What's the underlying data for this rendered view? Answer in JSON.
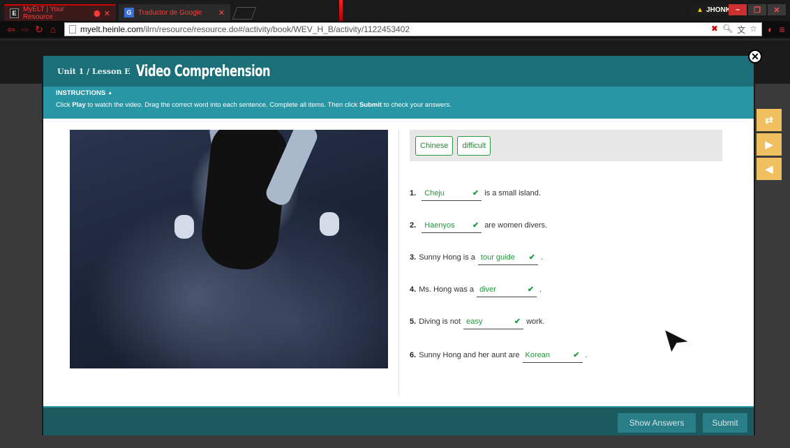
{
  "browser": {
    "tabs": [
      {
        "label": "MyELT | Your Resource",
        "icon": "E"
      },
      {
        "label": "Traductor de Google",
        "icon": "G"
      }
    ],
    "profile_name": "JHONKA",
    "url_host": "myelt.heinle.com",
    "url_path": "/ilrn/resource/resource.do#/activity/book/WEV_H_B/activity/1122453402"
  },
  "modal": {
    "lesson_label": "Unit 1 / Lesson E",
    "title": "Video Comprehension",
    "instructions_title": "INSTRUCTIONS",
    "instructions_pre": "Click ",
    "instructions_play": "Play",
    "instructions_mid": " to watch the video. Drag the correct word into each sentence. Complete all items. Then click ",
    "instructions_submit": "Submit",
    "instructions_post": " to check your answers."
  },
  "word_bank": [
    "Chinese",
    "difficult"
  ],
  "items": [
    {
      "num": "1.",
      "pre": "",
      "answer": "Cheju",
      "post": "is a small island."
    },
    {
      "num": "2.",
      "pre": "",
      "answer": "Haenyos",
      "post": "are women divers."
    },
    {
      "num": "3.",
      "pre": "Sunny Hong is a",
      "answer": "tour guide",
      "post": "."
    },
    {
      "num": "4.",
      "pre": "Ms. Hong was a",
      "answer": "diver",
      "post": "."
    },
    {
      "num": "5.",
      "pre": "Diving is not",
      "answer": "easy",
      "post": "work."
    },
    {
      "num": "6.",
      "pre": "Sunny Hong and her aunt are",
      "answer": "Korean",
      "post": "."
    }
  ],
  "footer": {
    "show_answers": "Show Answers",
    "submit": "Submit"
  },
  "colors": {
    "header": "#1a6f78",
    "instructions": "#2896a5",
    "correct": "#1f9a3a",
    "side_nav": "#f0c060"
  }
}
